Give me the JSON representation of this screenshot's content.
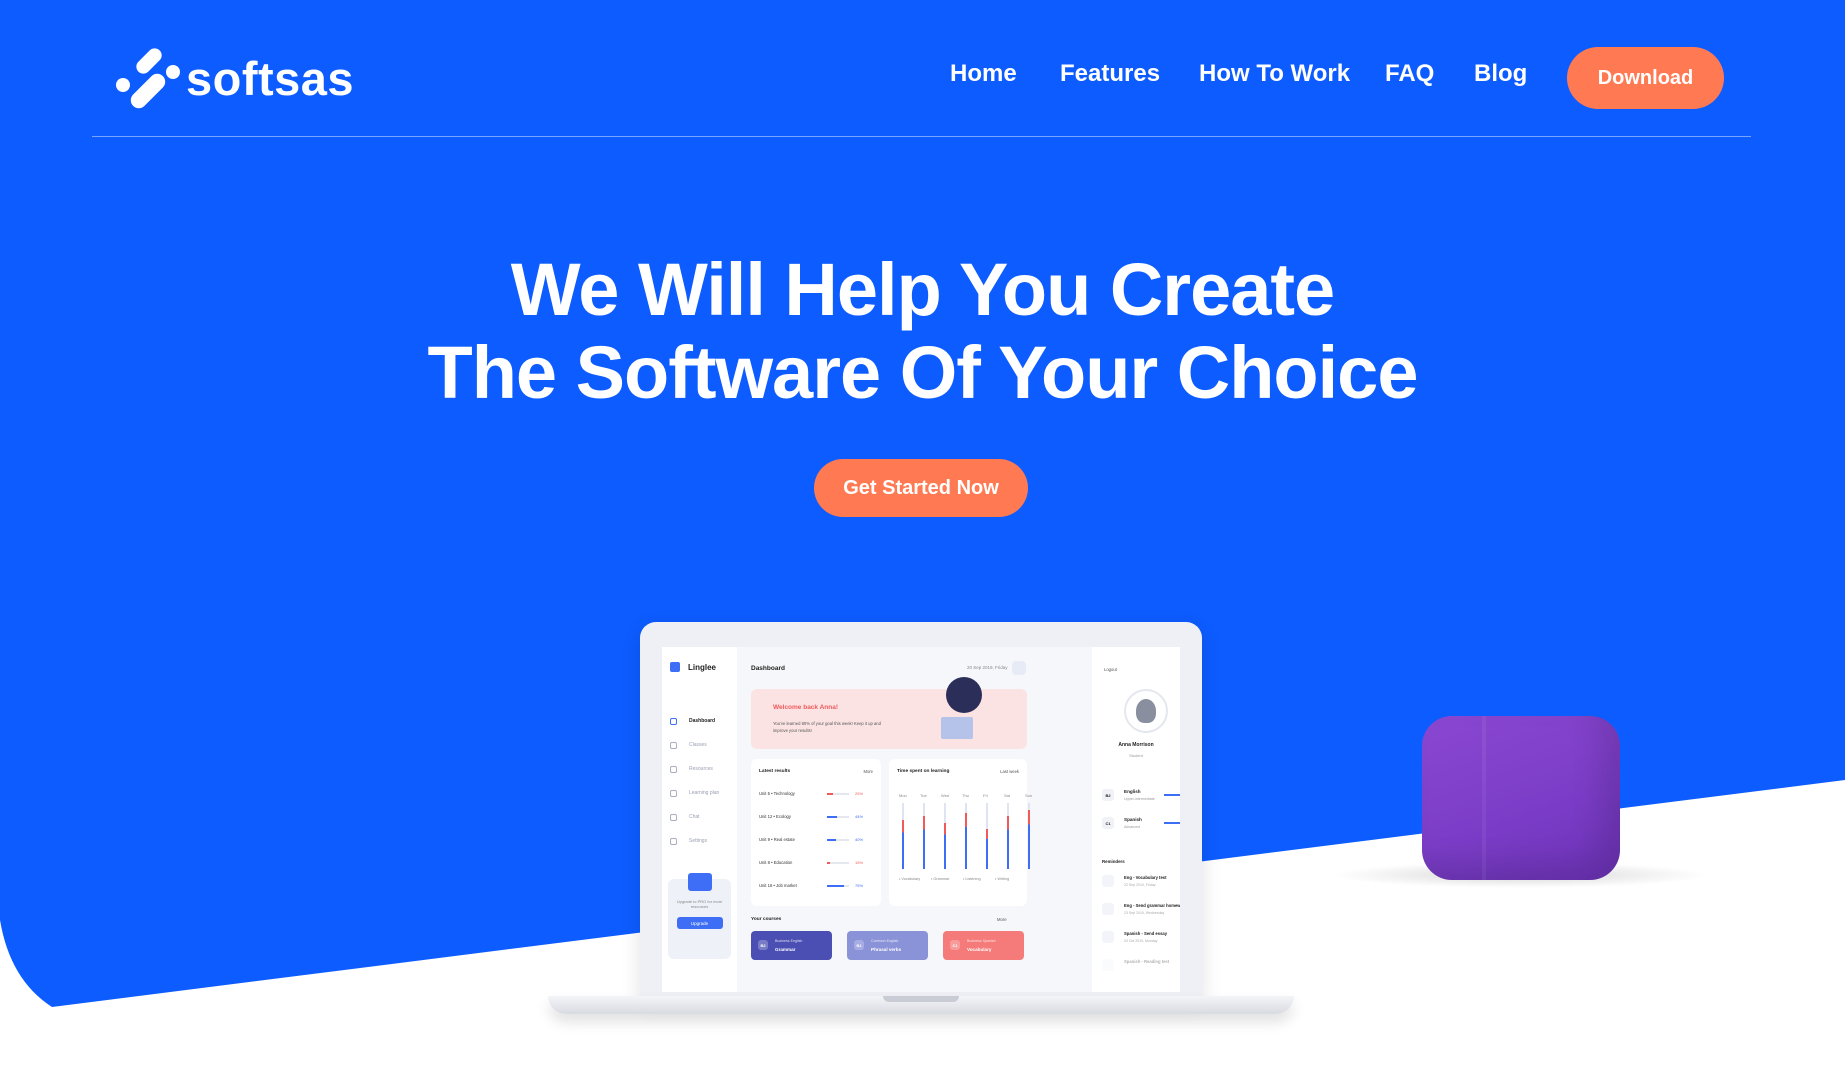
{
  "brand": {
    "name": "softsas",
    "primary_color": "#0d5cff",
    "accent_color": "#ff7a52"
  },
  "nav": {
    "items": [
      "Home",
      "Features",
      "How To Work",
      "FAQ",
      "Blog"
    ],
    "download_label": "Download"
  },
  "hero": {
    "title_line1": "We Will Help You Create",
    "title_line2": "The Software Of Your Choice",
    "cta_label": "Get Started Now"
  },
  "mockup": {
    "app_name": "Linglee",
    "sidebar": [
      "Dashboard",
      "Classes",
      "Resources",
      "Learning plan",
      "Chat",
      "Settings"
    ],
    "upgrade_text": "Upgrade to PRO for more resources",
    "upgrade_button": "Upgrade",
    "dashboard_title": "Dashboard",
    "date": "20 Sep 2019, Friday",
    "welcome_title": "Welcome back Anna!",
    "welcome_text": "You've learned 80% of your goal this week! Keep it up and improve your results!",
    "latest_results_title": "Latest results",
    "more": "More",
    "results": [
      {
        "label": "Unit 5 • Technology",
        "pct": "25%",
        "value": 0.25,
        "color": "#f05a5a"
      },
      {
        "label": "Unit 12 • Ecology",
        "pct": "44%",
        "value": 0.44,
        "color": "#3d6ef5"
      },
      {
        "label": "Unit 9 • Real estate",
        "pct": "40%",
        "value": 0.4,
        "color": "#3d6ef5"
      },
      {
        "label": "Unit 8 • Education",
        "pct": "15%",
        "value": 0.15,
        "color": "#f05a5a"
      },
      {
        "label": "Unit 16 • Job market",
        "pct": "75%",
        "value": 0.75,
        "color": "#3d6ef5"
      }
    ],
    "time_title": "Time spent on learning",
    "time_period": "Last week",
    "days": [
      "Mon",
      "Tue",
      "Wed",
      "Thu",
      "Fri",
      "Sat",
      "Sun"
    ],
    "day_values": [
      0.75,
      0.8,
      0.7,
      0.85,
      0.6,
      0.8,
      0.9
    ],
    "legend": [
      "Vocabulary",
      "Grammar",
      "Listening",
      "Writing"
    ],
    "courses_title": "Your courses",
    "courses": [
      {
        "level": "B2",
        "sub": "Business English",
        "name": "Grammar",
        "color": "#4b4fb3"
      },
      {
        "level": "B1",
        "sub": "Common English",
        "name": "Phrasal verbs",
        "color": "#8a92d8"
      },
      {
        "level": "C1",
        "sub": "Business Spanish",
        "name": "Vocabulary",
        "color": "#f57a7a"
      }
    ],
    "logout": "Logout",
    "profile_name": "Anna Morrison",
    "profile_role": "Student",
    "languages": [
      {
        "code": "B2",
        "name": "English",
        "level": "Upper-intermediate"
      },
      {
        "code": "C1",
        "name": "Spanish",
        "level": "Advanced"
      }
    ],
    "reminders_title": "Reminders",
    "reminders": [
      {
        "title": "Eng - Vocabulary test",
        "date": "22 Sep 2019, Friday"
      },
      {
        "title": "Eng - Send grammar homework",
        "date": "23 Sep 2019, Wednesday"
      },
      {
        "title": "Spanish - Send essay",
        "date": "03 Oct 2019, Monday"
      },
      {
        "title": "Spanish - Reading test",
        "date": ""
      }
    ]
  }
}
